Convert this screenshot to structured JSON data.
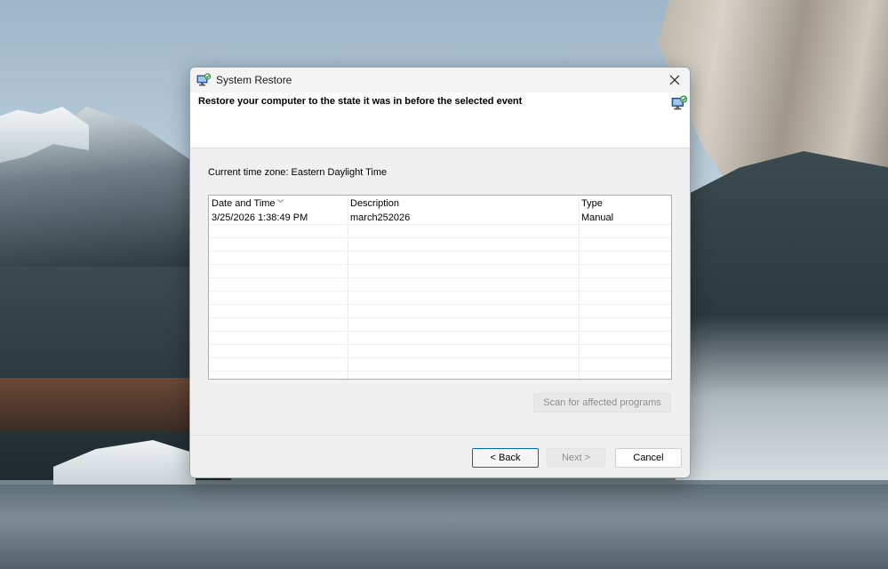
{
  "window": {
    "title": "System Restore",
    "close_icon": "close-icon",
    "app_icon": "system-restore-icon"
  },
  "header": {
    "text": "Restore your computer to the state it was in before the selected event",
    "icon": "system-restore-icon"
  },
  "timezone": {
    "label": "Current time zone: Eastern Daylight Time"
  },
  "restore_points": {
    "columns": [
      "Date and Time",
      "Description",
      "Type"
    ],
    "sort_icon": "chevron-down-icon",
    "rows": [
      {
        "date": "3/25/2026 1:38:49 PM",
        "description": "march252026",
        "type": "Manual"
      }
    ]
  },
  "buttons": {
    "scan": "Scan for affected programs",
    "back": "< Back",
    "next": "Next >",
    "cancel": "Cancel"
  },
  "colors": {
    "accent": "#0067c0",
    "disabled_text": "#8c8c8c"
  }
}
